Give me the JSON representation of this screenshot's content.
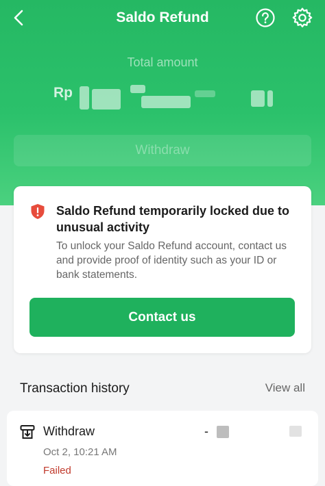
{
  "header": {
    "title": "Saldo Refund",
    "back_icon": "chevron-left-icon",
    "help_icon": "question-circle-icon",
    "settings_icon": "gear-icon"
  },
  "balance": {
    "total_label": "Total amount",
    "currency": "Rp",
    "withdraw_label": "Withdraw"
  },
  "alert": {
    "icon": "shield-warning-icon",
    "title": "Saldo Refund temporarily locked due to unusual activity",
    "body": "To unlock your Saldo Refund account, contact us and provide proof of identity such as your ID or bank statements.",
    "button_label": "Contact us"
  },
  "history": {
    "title": "Transaction history",
    "view_all_label": "View all",
    "items": [
      {
        "icon": "withdraw-icon",
        "name": "Withdraw",
        "amount_prefix": "-",
        "date": "Oct 2, 10:21 AM",
        "status": "Failed"
      }
    ]
  },
  "colors": {
    "brand_green": "#1fb15d",
    "failed_red": "#c0392b",
    "warning_red": "#e74c3c"
  }
}
